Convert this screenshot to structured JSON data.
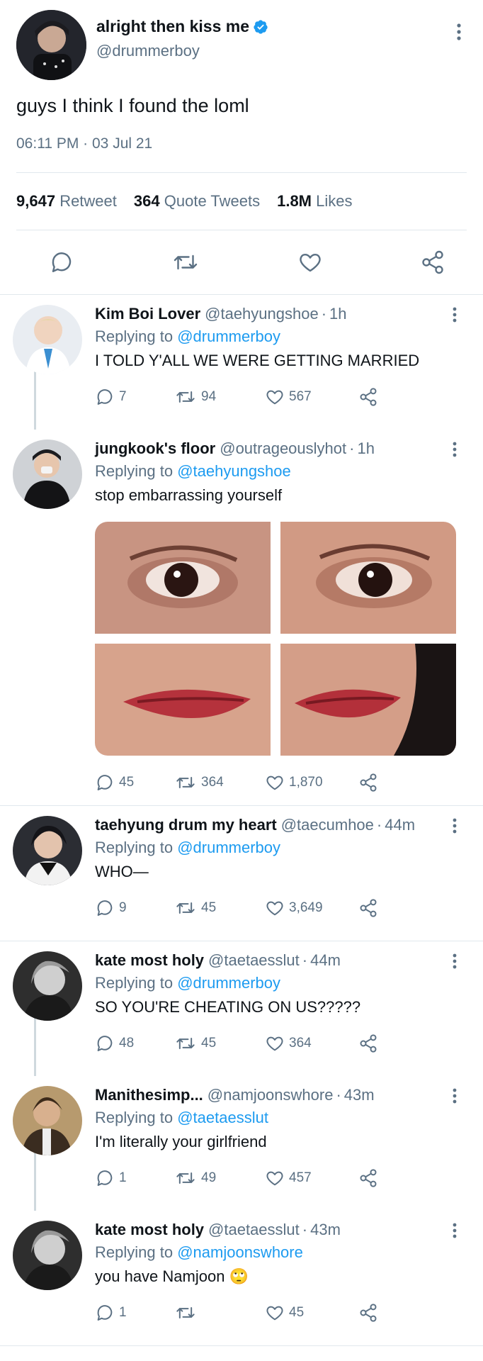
{
  "tweet": {
    "author_name": "alright then kiss me",
    "author_handle": "@drummerboy",
    "text": "guys I think I found the loml",
    "time": "06:11 PM",
    "date": "03 Jul 21",
    "retweets": "9,647",
    "retweets_label": "Retweet",
    "quotes": "364",
    "quotes_label": "Quote Tweets",
    "likes": "1.8M",
    "likes_label": "Likes",
    "icons": [
      "reply-icon",
      "retweet-icon",
      "like-icon",
      "share-icon"
    ]
  },
  "replies": [
    {
      "name": "Kim Boi Lover",
      "handle": "@taehyungshoe",
      "time": "1h",
      "replying_prefix": "Replying to",
      "replying_to": "@drummerboy",
      "text": "I TOLD Y'ALL WE WERE GETTING MARRIED",
      "reply_count": "7",
      "retweet_count": "94",
      "like_count": "567"
    },
    {
      "name": "jungkook's floor",
      "handle": "@outrageouslyhot",
      "time": "1h",
      "replying_prefix": "Replying to",
      "replying_to": "@taehyungshoe",
      "text": "stop embarrassing yourself",
      "reply_count": "45",
      "retweet_count": "364",
      "like_count": "1,870"
    },
    {
      "name": "taehyung drum my heart",
      "handle": "@taecumhoe",
      "time": "44m",
      "replying_prefix": "Replying to",
      "replying_to": "@drummerboy",
      "text": "WHO—",
      "reply_count": "9",
      "retweet_count": "45",
      "like_count": "3,649"
    },
    {
      "name": "kate most holy",
      "handle": "@taetaesslut",
      "time": "44m",
      "replying_prefix": "Replying to",
      "replying_to": "@drummerboy",
      "text": "SO YOU'RE CHEATING ON US?????",
      "reply_count": "48",
      "retweet_count": "45",
      "like_count": "364"
    },
    {
      "name": "Manithesimp...",
      "handle": "@namjoonswhore",
      "time": "43m",
      "replying_prefix": "Replying to",
      "replying_to": "@taetaesslut",
      "text": "I'm literally your girlfriend",
      "reply_count": "1",
      "retweet_count": "49",
      "like_count": "457"
    },
    {
      "name": "kate most holy",
      "handle": "@taetaesslut",
      "time": "43m",
      "replying_prefix": "Replying to",
      "replying_to": "@namjoonswhore",
      "text": "you have Namjoon 🙄",
      "reply_count": "1",
      "retweet_count": "",
      "like_count": "45"
    }
  ],
  "colors": {
    "link": "#1d9bf0",
    "muted": "#5b7083",
    "divider": "#e1e8ed",
    "verified": "#1d9bf0"
  }
}
